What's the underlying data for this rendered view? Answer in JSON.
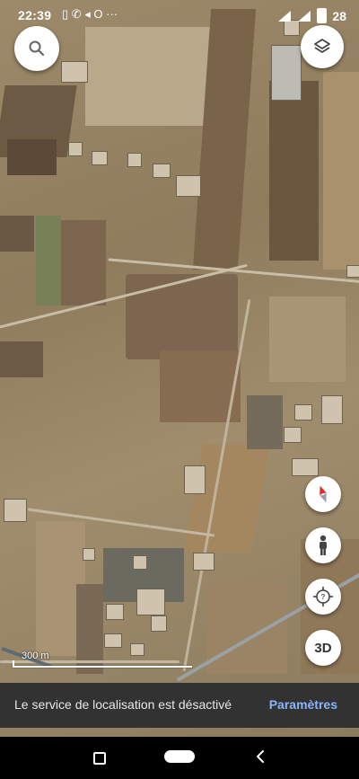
{
  "status_bar": {
    "time": "22:39",
    "notification_icons": "▯ ✆ ◂ O ···",
    "battery_level": "28"
  },
  "map": {
    "type": "satellite",
    "scale_label": "300 m"
  },
  "controls": {
    "search_icon": "search-icon",
    "layers_icon": "layers-icon",
    "compass_icon": "compass-icon",
    "pegman_icon": "pegman-icon",
    "location_icon": "location-target-icon",
    "view_3d_label": "3D"
  },
  "snackbar": {
    "message": "Le service de localisation est désactivé",
    "action_label": "Paramètres"
  },
  "colors": {
    "snackbar_bg": "#323232",
    "snackbar_action": "#8ab4f8",
    "compass_red": "#d93025"
  }
}
